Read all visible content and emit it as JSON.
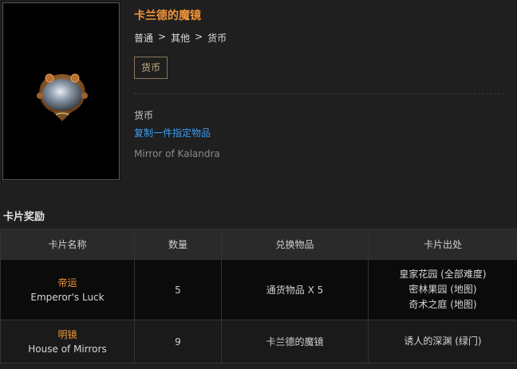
{
  "item": {
    "title": "卡兰德的魔镜",
    "breadcrumb": [
      "普通",
      ">",
      "其他",
      ">",
      "货币"
    ],
    "tag": "货币",
    "category": "货币",
    "effect": "复制一件指定物品",
    "english_name": "Mirror of Kalandra"
  },
  "card_section": {
    "title": "卡片奖励",
    "headers": [
      "卡片名称",
      "数量",
      "兑换物品",
      "卡片出处"
    ],
    "rows": [
      {
        "name_cn": "帝运",
        "name_en": "Emperor's Luck",
        "quantity": "5",
        "reward": "通货物品 X 5",
        "sources": [
          "皇家花园 (全部难度)",
          "密林果园 (地图)",
          "奇术之庭 (地图)"
        ]
      },
      {
        "name_cn": "明镜",
        "name_en": "House of Mirrors",
        "quantity": "9",
        "reward": "卡兰德的魔镜",
        "sources": [
          "诱人的深渊 (绿门)"
        ]
      }
    ]
  },
  "colors": {
    "accent_orange": "#f0953a",
    "link_blue": "#3b9cf0",
    "tag_gold": "#c8b084"
  }
}
